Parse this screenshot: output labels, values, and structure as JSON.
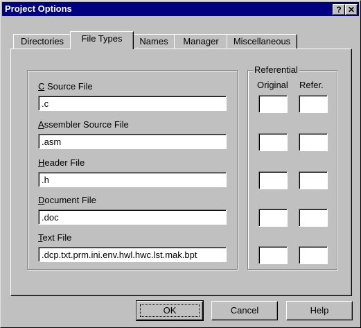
{
  "window": {
    "title": "Project Options",
    "help_button": "?",
    "close_button": "✕"
  },
  "tabs": [
    {
      "label": "Directories",
      "active": false
    },
    {
      "label": "File Types",
      "active": true
    },
    {
      "label": "Names",
      "active": false
    },
    {
      "label": "Manager",
      "active": false
    },
    {
      "label": "Miscellaneous",
      "active": false
    }
  ],
  "file_types": {
    "fields": [
      {
        "mnemonic": "C",
        "label_rest": " Source File",
        "value": ".c"
      },
      {
        "mnemonic": "A",
        "label_rest": "ssembler Source File",
        "value": ".asm"
      },
      {
        "mnemonic": "H",
        "label_rest": "eader File",
        "value": ".h"
      },
      {
        "mnemonic": "D",
        "label_rest": "ocument File",
        "value": ".doc"
      },
      {
        "mnemonic": "T",
        "label_rest": "ext File",
        "value": ".dcp.txt.prm.ini.env.hwl.hwc.lst.mak.bpt"
      }
    ]
  },
  "referential": {
    "title": "Referential",
    "col_original": "Original",
    "col_refer": "Refer."
  },
  "buttons": {
    "ok": "OK",
    "cancel": "Cancel",
    "help": "Help"
  }
}
